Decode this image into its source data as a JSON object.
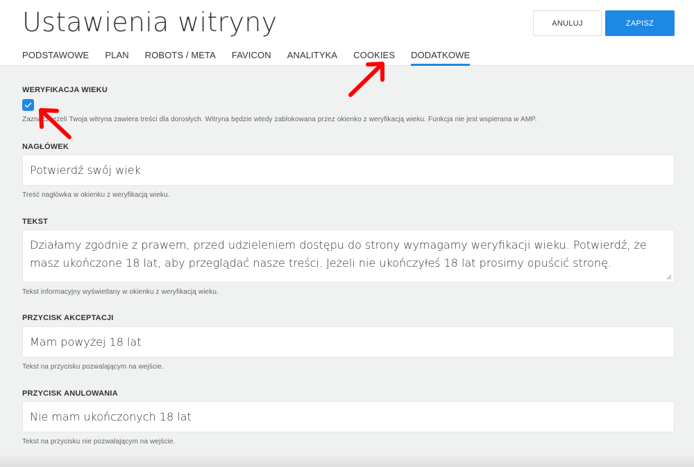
{
  "header": {
    "title": "Ustawienia witryny",
    "cancel_label": "ANULUJ",
    "save_label": "ZAPISZ"
  },
  "tabs": [
    {
      "label": "PODSTAWOWE",
      "active": false
    },
    {
      "label": "PLAN",
      "active": false
    },
    {
      "label": "ROBOTS / META",
      "active": false
    },
    {
      "label": "FAVICON",
      "active": false
    },
    {
      "label": "ANALITYKA",
      "active": false
    },
    {
      "label": "COOKIES",
      "active": false
    },
    {
      "label": "DODATKOWE",
      "active": true
    }
  ],
  "age_verification": {
    "label": "WERYFIKACJA WIEKU",
    "checked": true,
    "help": "Zaznacz jeżeli Twoja witryna zawiera treści dla dorosłych. Witryna będzie wtedy zablokowana przez okienko z weryfikacją wieku. Funkcja nie jest wspierana w AMP."
  },
  "heading_field": {
    "label": "NAGŁÓWEK",
    "value": "Potwierdź swój wiek",
    "help": "Treść nagłówka w okienku z weryfikacją wieku."
  },
  "text_field": {
    "label": "TEKST",
    "value": "Działamy zgodnie z prawem, przed udzieleniem dostępu do strony wymagamy weryfikacji wieku. Potwierdź, że masz ukończone 18 lat, aby przeglądać nasze treści. Jeżeli nie ukończyłeś 18 lat prosimy opuścić stronę.",
    "help": "Tekst informacyjny wyświetlany w okienku z weryfikacją wieku."
  },
  "accept_button_field": {
    "label": "PRZYCISK AKCEPTACJI",
    "value": "Mam powyżej 18 lat",
    "help": "Tekst na przycisku pozwalającym na wejście."
  },
  "cancel_button_field": {
    "label": "PRZYCISK ANULOWANIA",
    "value": "Nie mam ukończonych 18 lat",
    "help": "Tekst na przycisku nie pozwalającym na wejście."
  },
  "colors": {
    "accent": "#1e88e5",
    "annotation": "#ff0000",
    "background": "#f0f1f1"
  }
}
